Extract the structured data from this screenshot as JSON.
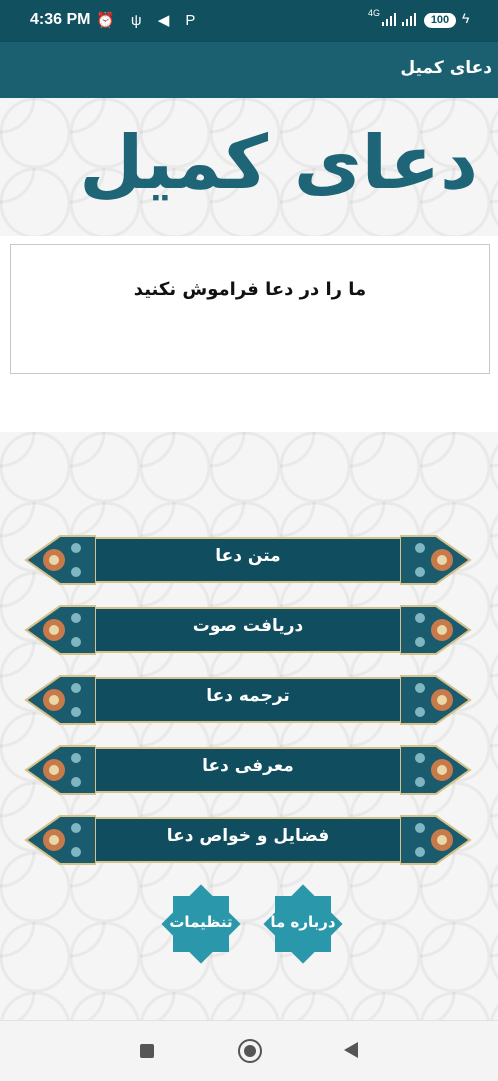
{
  "status_bar": {
    "time": "4:36 PM",
    "left_icons": [
      "alarm-icon",
      "usb-icon",
      "send-icon",
      "p-icon"
    ],
    "left_glyphs": "⏰ ψ ◀ P",
    "network": "4G",
    "battery": "100"
  },
  "app_bar": {
    "title": "دعای کمیل"
  },
  "header": {
    "logo_text": "دعای کمیل"
  },
  "notice": {
    "text": "ما را در دعا فراموش نکنید"
  },
  "menu": [
    {
      "label": "متن دعا"
    },
    {
      "label": "دریافت صوت"
    },
    {
      "label": "ترجمه دعا"
    },
    {
      "label": "معرفی دعا"
    },
    {
      "label": "فضایل و خواص دعا"
    }
  ],
  "bottom_buttons": {
    "settings": "تنظیمات",
    "about": "درباره ما"
  },
  "colors": {
    "primary": "#1b6070",
    "status": "#10505f",
    "button": "#104e5f",
    "gold": "#d6c28a",
    "star": "#2a98aa"
  }
}
